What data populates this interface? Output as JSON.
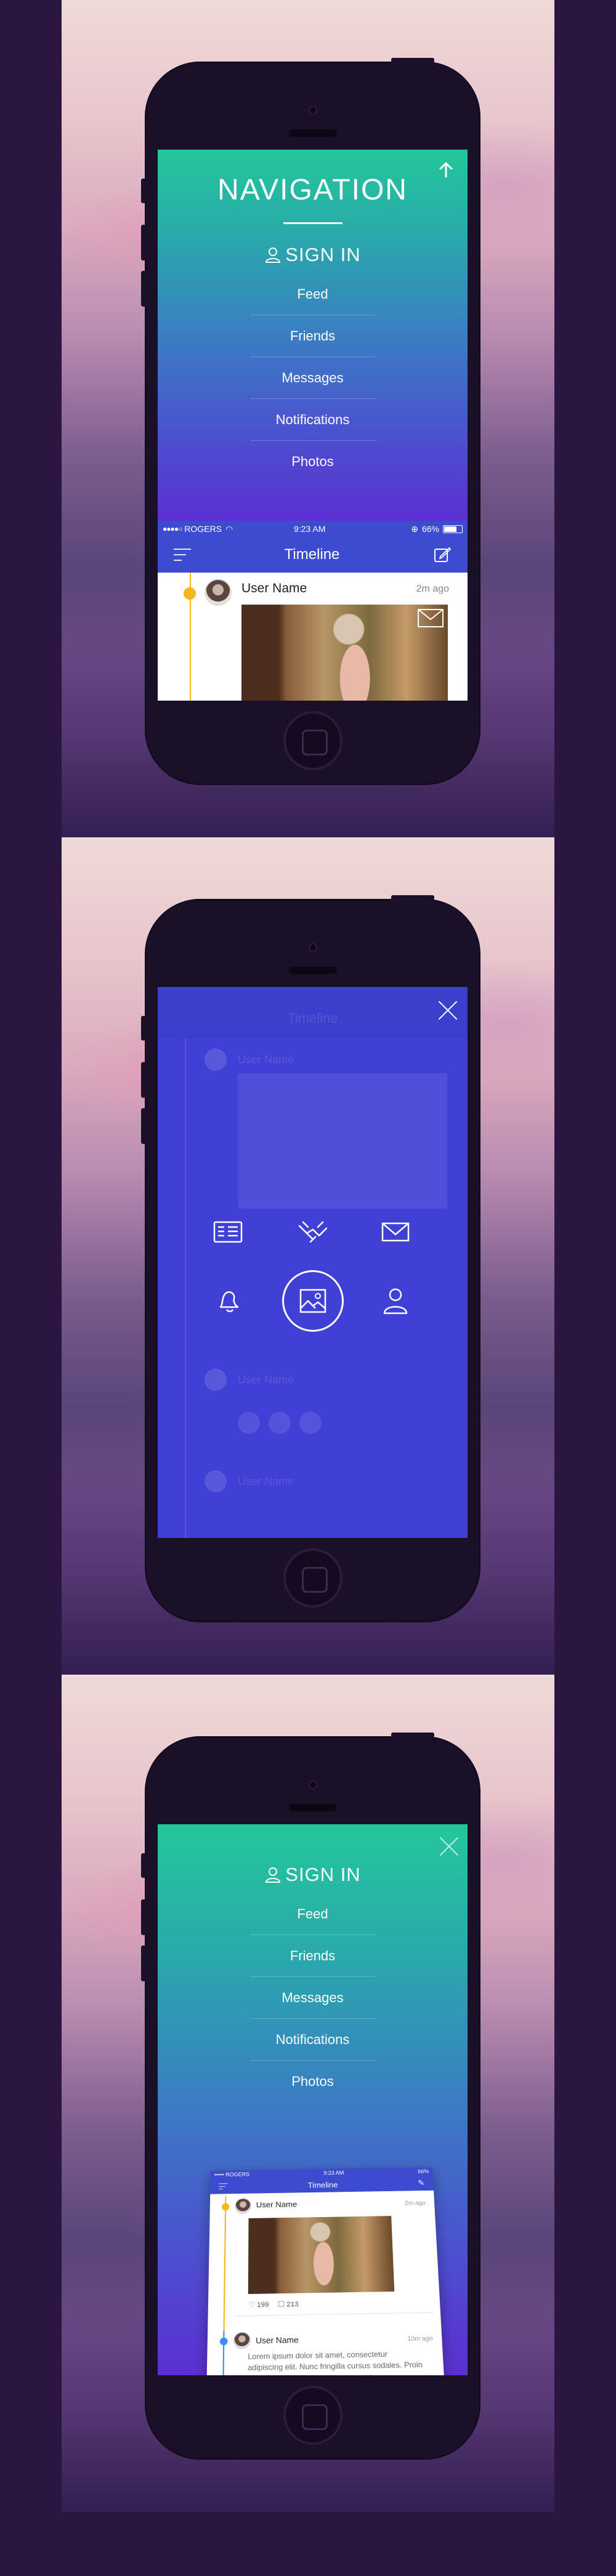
{
  "screens": {
    "one": {
      "title": "NAVIGATION",
      "sign_in": "SIGN IN",
      "menu": [
        "Feed",
        "Friends",
        "Messages",
        "Notifications",
        "Photos"
      ],
      "status": {
        "carrier": "ROGERS",
        "time": "9:23 AM",
        "battery": "66%"
      },
      "app_title": "Timeline",
      "post": {
        "user": "User Name",
        "time": "2m ago"
      }
    },
    "two": {
      "app_title": "Timeline",
      "ghost_names": [
        "User Name",
        "User Name",
        "User Name"
      ],
      "icons": [
        "newspaper-icon",
        "handshake-icon",
        "mail-icon",
        "bell-icon",
        "image-icon",
        "user-icon"
      ],
      "active_icon": "image-icon"
    },
    "three": {
      "sign_in": "SIGN IN",
      "menu": [
        "Feed",
        "Friends",
        "Messages",
        "Notifications",
        "Photos"
      ],
      "card": {
        "status_carrier": "••••• ROGERS",
        "status_time": "9:23 AM",
        "status_battery": "66%",
        "title": "Timeline",
        "post1_user": "User Name",
        "post1_time": "2m ago",
        "likes": "199",
        "comments": "213",
        "post2_user": "User Name",
        "post2_time": "10m ago",
        "post2_text": "Lorem ipsum dolor sit amet, consectetur adipiscing elit. Nunc fringilla cursus sodales. Proin hendrerit tempor purus non posuere."
      }
    }
  },
  "colors": {
    "gradient_top": "#23c79a",
    "gradient_bottom": "#5c2fd2",
    "app_bar": "#3d4bd1",
    "overlay": "#4140d6",
    "timeline_yellow": "#f5b51c",
    "timeline_blue": "#3c8ef0",
    "page_background": "#2a1640"
  }
}
